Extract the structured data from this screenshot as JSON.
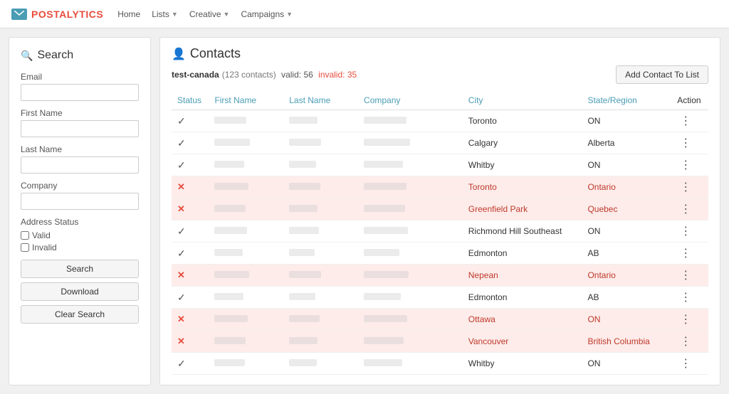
{
  "navbar": {
    "logo_text_main": "POSTAL",
    "logo_text_accent": "YTICS",
    "nav_items": [
      {
        "label": "Home",
        "has_dropdown": false
      },
      {
        "label": "Lists",
        "has_dropdown": true
      },
      {
        "label": "Creative",
        "has_dropdown": true
      },
      {
        "label": "Campaigns",
        "has_dropdown": true
      }
    ]
  },
  "sidebar": {
    "title": "Search",
    "email_label": "Email",
    "email_placeholder": "",
    "firstname_label": "First Name",
    "firstname_placeholder": "",
    "lastname_label": "Last Name",
    "lastname_placeholder": "",
    "company_label": "Company",
    "company_placeholder": "",
    "address_status_label": "Address Status",
    "valid_label": "Valid",
    "invalid_label": "Invalid",
    "search_btn": "Search",
    "download_btn": "Download",
    "clear_btn": "Clear Search"
  },
  "content": {
    "title": "Contacts",
    "list_name": "test-canada",
    "total_contacts": "123 contacts",
    "valid_label": "valid:",
    "valid_count": "56",
    "invalid_label": "invalid:",
    "invalid_count": "35",
    "add_btn_label": "Add Contact To List",
    "table": {
      "columns": [
        "Status",
        "First Name",
        "Last Name",
        "Company",
        "City",
        "State/Region",
        "Action"
      ],
      "rows": [
        {
          "status": "valid",
          "city": "Toronto",
          "state": "ON"
        },
        {
          "status": "valid",
          "city": "Calgary",
          "state": "Alberta"
        },
        {
          "status": "valid",
          "city": "Whitby",
          "state": "ON"
        },
        {
          "status": "invalid",
          "city": "Toronto",
          "state": "Ontario"
        },
        {
          "status": "invalid",
          "city": "Greenfield Park",
          "state": "Quebec"
        },
        {
          "status": "valid",
          "city": "Richmond Hill Southeast",
          "state": "ON"
        },
        {
          "status": "valid",
          "city": "Edmonton",
          "state": "AB"
        },
        {
          "status": "invalid",
          "city": "Nepean",
          "state": "Ontario"
        },
        {
          "status": "valid",
          "city": "Edmonton",
          "state": "AB"
        },
        {
          "status": "invalid",
          "city": "Ottawa",
          "state": "ON"
        },
        {
          "status": "invalid",
          "city": "Vancouver",
          "state": "British Columbia"
        },
        {
          "status": "valid",
          "city": "Whitby",
          "state": "ON"
        }
      ]
    }
  },
  "blurred_widths": [
    [
      45,
      40,
      60
    ],
    [
      50,
      45,
      65
    ],
    [
      42,
      38,
      55
    ],
    [
      48,
      44,
      60
    ],
    [
      44,
      40,
      58
    ],
    [
      46,
      42,
      62
    ],
    [
      40,
      36,
      50
    ],
    [
      49,
      45,
      63
    ],
    [
      41,
      37,
      52
    ],
    [
      47,
      43,
      61
    ],
    [
      44,
      40,
      56
    ],
    [
      43,
      39,
      54
    ]
  ]
}
